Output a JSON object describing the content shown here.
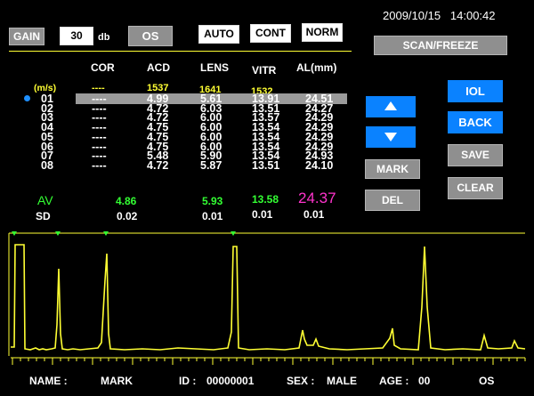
{
  "datetime": "2009/10/15   14:00:42",
  "controls": {
    "gain_label": "GAIN",
    "gain_value": "30",
    "gain_unit": "db",
    "eye": "OS",
    "mode_auto": "AUTO",
    "mode_cont": "CONT",
    "mode_norm": "NORM",
    "scan_freeze": "SCAN/FREEZE"
  },
  "table": {
    "headers": [
      "COR",
      "ACD",
      "LENS",
      "VITR",
      "AL(mm)"
    ],
    "velocity_label": "(m/s)",
    "velocities": [
      "----",
      "1537",
      "1641",
      "1532"
    ],
    "rows": [
      {
        "no": "01",
        "cor": "----",
        "acd": "4.99",
        "lens": "5.61",
        "vitr": "13.91",
        "al": "24.51"
      },
      {
        "no": "02",
        "cor": "----",
        "acd": "4.72",
        "lens": "6.03",
        "vitr": "13.51",
        "al": "24.27"
      },
      {
        "no": "03",
        "cor": "----",
        "acd": "4.72",
        "lens": "6.00",
        "vitr": "13.57",
        "al": "24.29"
      },
      {
        "no": "04",
        "cor": "----",
        "acd": "4.75",
        "lens": "6.00",
        "vitr": "13.54",
        "al": "24.29"
      },
      {
        "no": "05",
        "cor": "----",
        "acd": "4.75",
        "lens": "6.00",
        "vitr": "13.54",
        "al": "24.29"
      },
      {
        "no": "06",
        "cor": "----",
        "acd": "4.75",
        "lens": "6.00",
        "vitr": "13.54",
        "al": "24.29"
      },
      {
        "no": "07",
        "cor": "----",
        "acd": "5.48",
        "lens": "5.90",
        "vitr": "13.54",
        "al": "24.93"
      },
      {
        "no": "08",
        "cor": "----",
        "acd": "4.72",
        "lens": "5.87",
        "vitr": "13.51",
        "al": "24.10"
      }
    ],
    "selected_row": "01",
    "av_label": "AV",
    "av": {
      "acd": "4.86",
      "lens": "5.93",
      "vitr": "13.58",
      "al": "24.37"
    },
    "sd_label": "SD",
    "sd": {
      "acd": "0.02",
      "lens": "0.01",
      "vitr": "0.01",
      "al": "0.01"
    }
  },
  "buttons": {
    "iol": "IOL",
    "back": "BACK",
    "save": "SAVE",
    "clear": "CLEAR",
    "mark": "MARK",
    "del": "DEL",
    "up": "up-arrow",
    "down": "down-arrow"
  },
  "colors": {
    "yellow": "#ffff33",
    "green": "#33ff33",
    "magenta": "#ff33cc",
    "blue": "#0a82ff",
    "gray": "#8f8f8f"
  },
  "footer": {
    "name_label": "NAME :",
    "name_value": "MARK",
    "id_label": "ID :",
    "id_value": "00000001",
    "sex_label": "SEX :",
    "sex_value": "MALE",
    "age_label": "AGE :",
    "age_value": "00",
    "eye": "OS"
  }
}
